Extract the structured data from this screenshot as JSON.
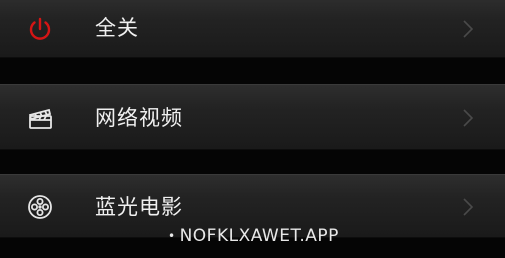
{
  "menu": {
    "items": [
      {
        "label": "全关",
        "icon": "power-icon",
        "icon_color": "#d41515"
      },
      {
        "label": "网络视频",
        "icon": "clapperboard-icon",
        "icon_color": "#e6e6e6"
      },
      {
        "label": "蓝光电影",
        "icon": "film-reel-icon",
        "icon_color": "#e6e6e6"
      }
    ],
    "chevron": "chevron-right-icon"
  },
  "watermark": {
    "bullet": "•",
    "text": "NOFKLXAWET.APP"
  },
  "colors": {
    "background": "#050505",
    "row": "#232323",
    "text": "#f0f0f0",
    "power_accent": "#d41515",
    "chevron": "#4a4a4a"
  }
}
